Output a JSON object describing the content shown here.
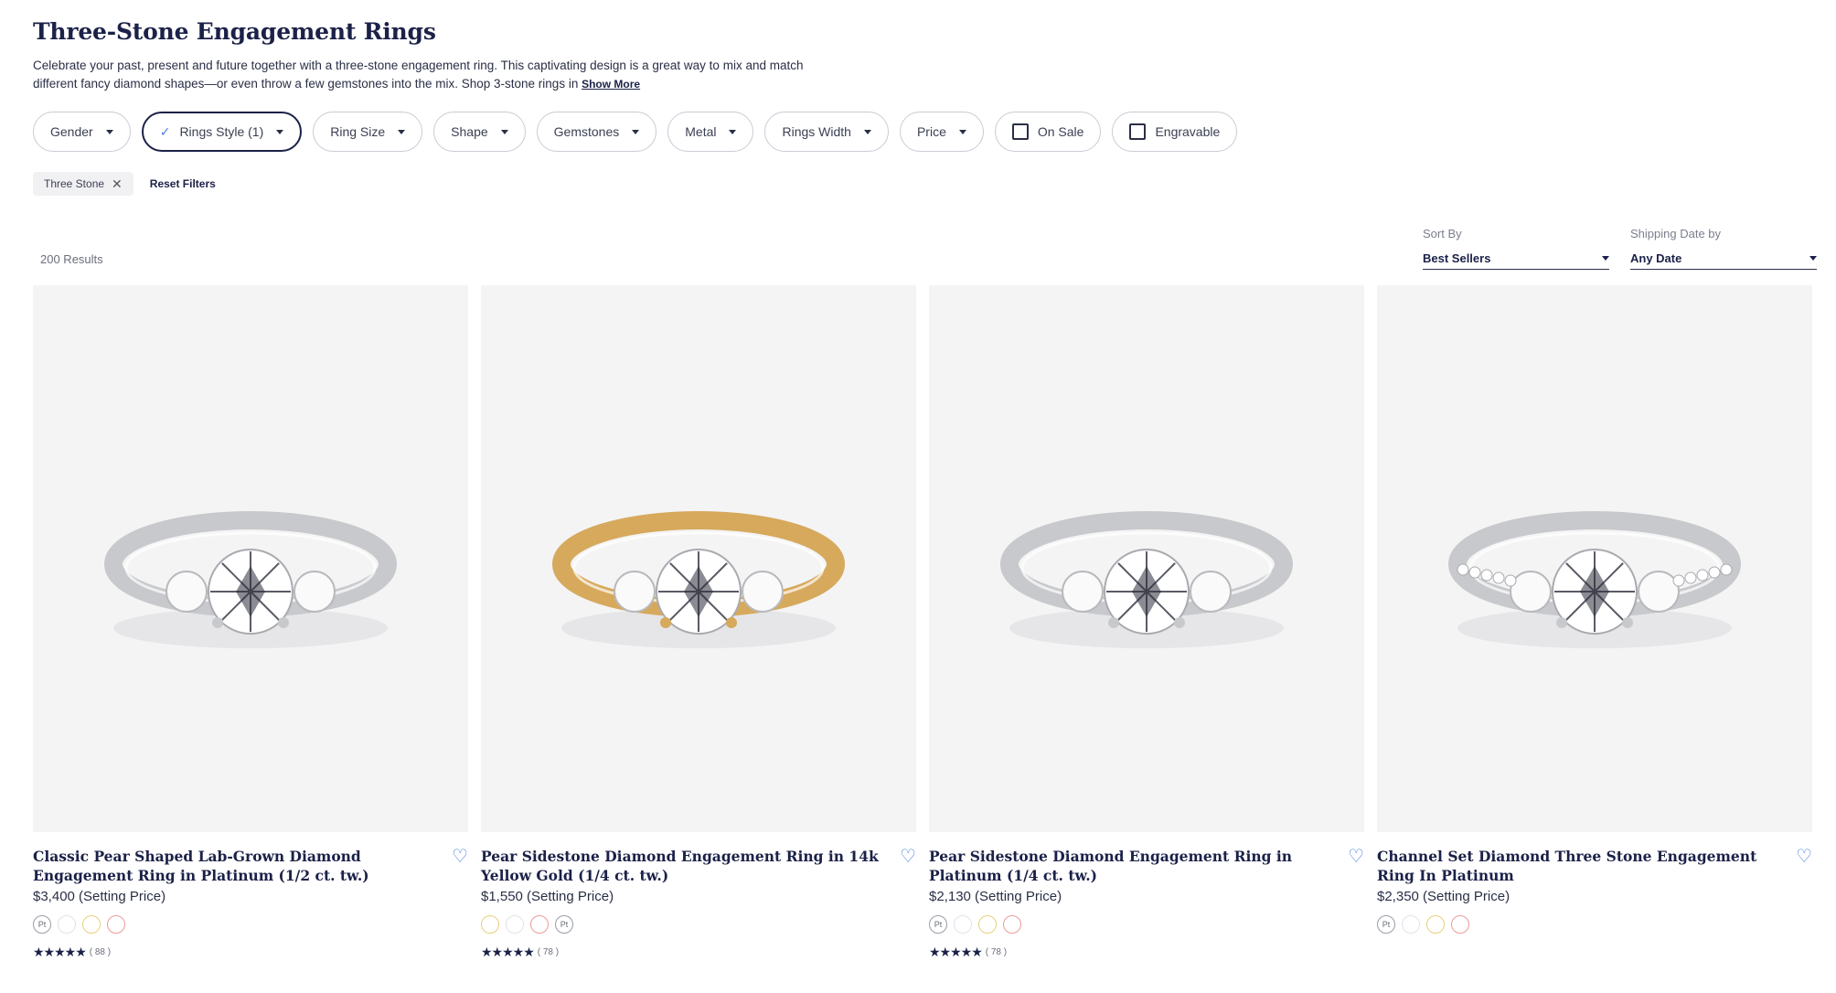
{
  "page": {
    "title": "Three-Stone Engagement Rings",
    "description": "Celebrate your past, present and future together with a three-stone engagement ring. This captivating design is a great way to mix and match different fancy diamond shapes—or even throw a few gemstones into the mix. Shop 3-stone rings in",
    "show_more": "Show More"
  },
  "filters": [
    {
      "label": "Gender"
    },
    {
      "label": "Rings Style (1)"
    },
    {
      "label": "Ring Size"
    },
    {
      "label": "Shape"
    },
    {
      "label": "Gemstones"
    },
    {
      "label": "Metal"
    },
    {
      "label": "Rings Width"
    },
    {
      "label": "Price"
    },
    {
      "label": "On Sale"
    },
    {
      "label": "Engravable"
    }
  ],
  "active_chip": "Three Stone",
  "reset_label": "Reset Filters",
  "results": "200 Results",
  "sort": {
    "label": "Sort By",
    "value": "Best Sellers"
  },
  "shipping": {
    "label": "Shipping Date by",
    "value": "Any Date"
  },
  "products": [
    {
      "name": "Classic Pear Shaped Lab-Grown Diamond Engagement Ring in Platinum (1/2 ct. tw.)",
      "price": "$3,400 (Setting Price)",
      "stars": "★★★★★",
      "reviews": "( 88 )",
      "metal": "white"
    },
    {
      "name": "Pear Sidestone Diamond Engagement Ring in 14k Yellow Gold (1/4 ct. tw.)",
      "price": "$1,550 (Setting Price)",
      "stars": "★★★★★",
      "reviews": "( 78 )",
      "metal": "yellow"
    },
    {
      "name": "Pear Sidestone Diamond Engagement Ring in Platinum (1/4 ct. tw.)",
      "price": "$2,130 (Setting Price)",
      "stars": "★★★★★",
      "reviews": "( 78 )",
      "metal": "white"
    },
    {
      "name": "Channel Set Diamond Three Stone Engagement Ring In Platinum",
      "price": "$2,350 (Setting Price)",
      "stars": "★★★★★",
      "reviews": "",
      "metal": "white"
    }
  ],
  "swatch_label": "Pt",
  "colors": {
    "navy": "#1b2148",
    "accent": "#4a7de0",
    "image_bg": "#f4f4f5",
    "gold": "#d6a95c",
    "platinum": "#c8c9cc"
  }
}
